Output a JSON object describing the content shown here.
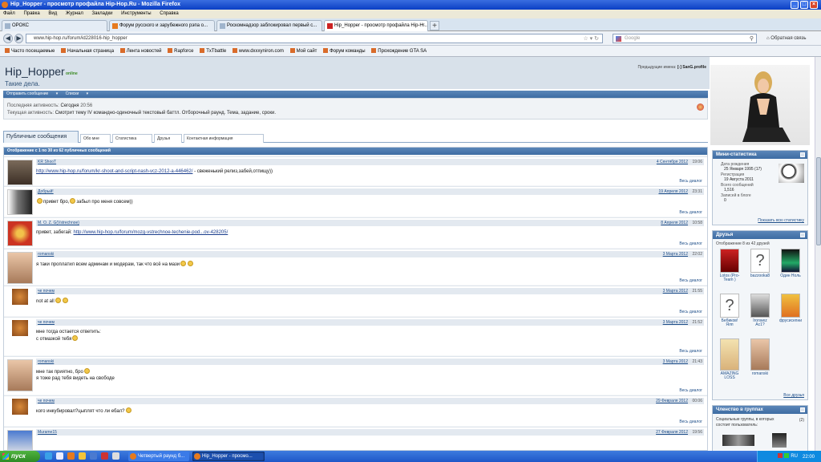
{
  "window": {
    "title": "Hip_Hopper - просмотр профайла Hip-Hop.Ru - Mozilla Firefox"
  },
  "menu": [
    "Файл",
    "Правка",
    "Вид",
    "Журнал",
    "Закладки",
    "Инструменты",
    "Справка"
  ],
  "tabs": [
    {
      "label": "ОРОКС"
    },
    {
      "label": "Форум русского и зарубежного рэпа о..."
    },
    {
      "label": "Роскомнадзор заблокировал первый с..."
    },
    {
      "label": "Hip_Hopper - просмотр профайла Hip-H..."
    }
  ],
  "nav": {
    "url": "www.hip-hop.ru/forum/id228016-hip_hopper",
    "search_placeholder": "Google",
    "feedback": "Обратная связь"
  },
  "bookmarks": [
    "Часто посещаемые",
    "Начальная страница",
    "Лента новостей",
    "Rapforce",
    "TxTbattle",
    "www.dxxxyniron.com",
    "Мой сайт",
    "Форум команды",
    "Прохождение GTA SA"
  ],
  "profile": {
    "username": "Hip_Hopper",
    "online": "online",
    "usertitle": "Такие дела.",
    "prev_names_label": "Предыдущие имена:",
    "prev_names": "[-] SanG.profile",
    "actions": [
      "Отправить сообщение",
      "Списки"
    ],
    "last_activity_label": "Последняя активность:",
    "last_activity_day": "Сегодня",
    "last_activity_time": "20:56",
    "current_activity_label": "Текущая активность:",
    "current_activity": "Смотрит тему IV командно-одиночный текстовый баттл. Отборочный раунд. Тема, задание, сроки."
  },
  "profile_tabs": [
    "Публичные сообщения",
    "Обо мне",
    "Статистика",
    "Друзья",
    "Контактная информация"
  ],
  "messages_header": "Отображение с 1 по 30 из 62 публичных сообщений",
  "messages": [
    {
      "author": "KR ShooT",
      "date": "4 Сентября 2012",
      "time": "19:06",
      "text": "http://www.hip-hop.ru/forum/kr-shoot-and-script-nash-vcz-2012-a-446462/",
      "text2": " - свеженький релиз,забей,отпищу))",
      "full": "Весь диалог"
    },
    {
      "author": "Добрый!",
      "date": "19 Апреля 2012",
      "time": "23:31",
      "text": "привет бро,",
      "text2": "забыл про меня совсем))",
      "full": "Весь диалог"
    },
    {
      "author": "M. O. Z. G(Vstrechnoe)",
      "date": "8 Апреля 2012",
      "time": "10:58",
      "text": "привет, забегай: ",
      "link": "http://www.hip-hop.ru/forum/mozg-vstrechnoe-techenie-pod...ov-428205/",
      "full": "Весь диалог"
    },
    {
      "author": "romanski",
      "date": "3 Марта 2012",
      "time": "22:02",
      "text": "я таки проплатил всем админам и модерам, так что всё на мази",
      "full": "Весь диалог"
    },
    {
      "author": "че почем",
      "date": "3 Марта 2012",
      "time": "21:55",
      "text": "not at all",
      "full": "Весь диалог"
    },
    {
      "author": "че почем",
      "date": "3 Марта 2012",
      "time": "21:52",
      "text": "мне тогда остается ответить:",
      "text2": "с отмазкой тебя",
      "full": "Весь диалог"
    },
    {
      "author": "romanski",
      "date": "3 Марта 2012",
      "time": "21:43",
      "text": "мне так приятно, бро",
      "text2": "я тоже рад тебя видеть на свободе",
      "full": "Весь диалог"
    },
    {
      "author": "че почем",
      "date": "29 Февраля 2012",
      "time": "00:06",
      "text": "кого инкубировал?цыплят что ли ебал?",
      "full": "Весь диалог"
    },
    {
      "author": "Murame15",
      "date": "27 Февраля 2012",
      "time": "19:56",
      "text": "",
      "full": ""
    }
  ],
  "sidebar": {
    "mini_stats": {
      "title": "Мини-статистика",
      "birth_label": "Дата рождения",
      "birth": "25 Января 1995 (17)",
      "reg_label": "Регистрация",
      "reg": "19 Августа 2011",
      "posts_label": "Всего сообщений",
      "posts": "1,516",
      "blog_label": "Записей в блоге",
      "blog": "0",
      "show_all": "Показать всю статистику"
    },
    "friends": {
      "title": "Друзья",
      "count_text": "Отображение 8 из 42 друзей",
      "list": [
        "Lotos (Pro-Team )",
        "bazzooka8",
        "Один Ноль",
        "Бебиков! Ялп",
        "Ironwez Ac1?",
        "фрусисепни",
        "AMAZING LOSS",
        "romanski"
      ],
      "all": "Все друзья"
    },
    "groups": {
      "title": "Членство в группах",
      "text": "Социальные группы, в которых состоит пользователь:",
      "count": "(2)"
    }
  },
  "taskbar": {
    "start": "пуск",
    "tasks": [
      "Четвертый раунд б...",
      "Hip_Hopper - просмо..."
    ],
    "lang": "RU",
    "clock": "22:00"
  },
  "colors": {
    "accent": "#3d6ca3",
    "link": "#1f4f8a",
    "online": "#3a8a22"
  }
}
